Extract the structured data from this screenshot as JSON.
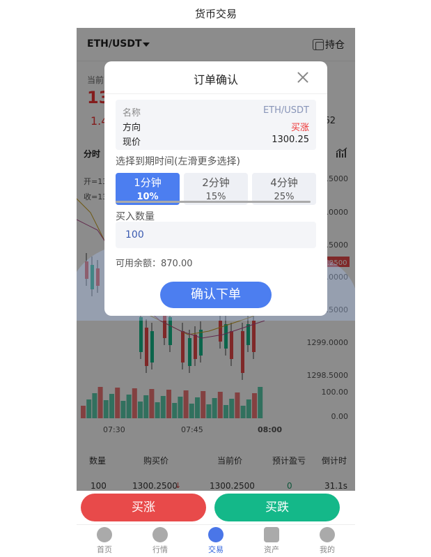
{
  "nav": {
    "title": "货币交易"
  },
  "pair": {
    "name": "ETH/USDT",
    "hold_label": "持仓"
  },
  "price": {
    "current_label": "当前",
    "current_value": "13",
    "change": "1.4",
    "right_value": "62"
  },
  "chart": {
    "period_tab": "分时",
    "ohlc_open": "开=13",
    "ohlc_close": "收=13",
    "y_ticks": [
      "1.5000",
      "1.0000",
      "0.5000",
      "1.2500",
      "1.0000",
      "0.5000",
      "1299.0000",
      "1298.5000",
      "100.00",
      "0.00"
    ],
    "current_tag": "1.2500",
    "x_ticks": [
      "07:30",
      "07:45",
      "08:00"
    ]
  },
  "chart_data": {
    "type": "bar",
    "title": "",
    "x": [
      "07:30",
      "07:45",
      "08:00"
    ],
    "volume_ylim": [
      0,
      100
    ],
    "price_ticks": [
      1298.5,
      1299.0
    ],
    "grid": false
  },
  "table": {
    "headers": [
      "数量",
      "购买价",
      "当前价",
      "预计盈亏",
      "倒计时"
    ],
    "row": {
      "qty": "100",
      "buy_price": "1300.2500",
      "cur_price": "1300.2500",
      "pnl": "0",
      "countdown": "31.1s"
    }
  },
  "actions": {
    "buy_label": "买涨",
    "sell_label": "买跌"
  },
  "tabbar": [
    {
      "label": "首页"
    },
    {
      "label": "行情"
    },
    {
      "label": "交易"
    },
    {
      "label": "资产"
    },
    {
      "label": "我的"
    }
  ],
  "modal": {
    "title": "订单确认",
    "info": [
      {
        "k": "名称",
        "v": "ETH/USDT"
      },
      {
        "k": "方向",
        "v": "买涨"
      },
      {
        "k": "现价",
        "v": "1300.25"
      }
    ],
    "expire_label": "选择到期时间(左滑更多选择)",
    "options": [
      {
        "time": "1分钟",
        "pct": "10%"
      },
      {
        "time": "2分钟",
        "pct": "15%"
      },
      {
        "time": "4分钟",
        "pct": "25%"
      }
    ],
    "qty_label": "买入数量",
    "qty_value": "100",
    "balance": "可用余额：870.00",
    "confirm_label": "确认下单"
  },
  "colors": {
    "up": "#e84a4a",
    "down": "#14b889",
    "accent": "#4c7ef0"
  }
}
